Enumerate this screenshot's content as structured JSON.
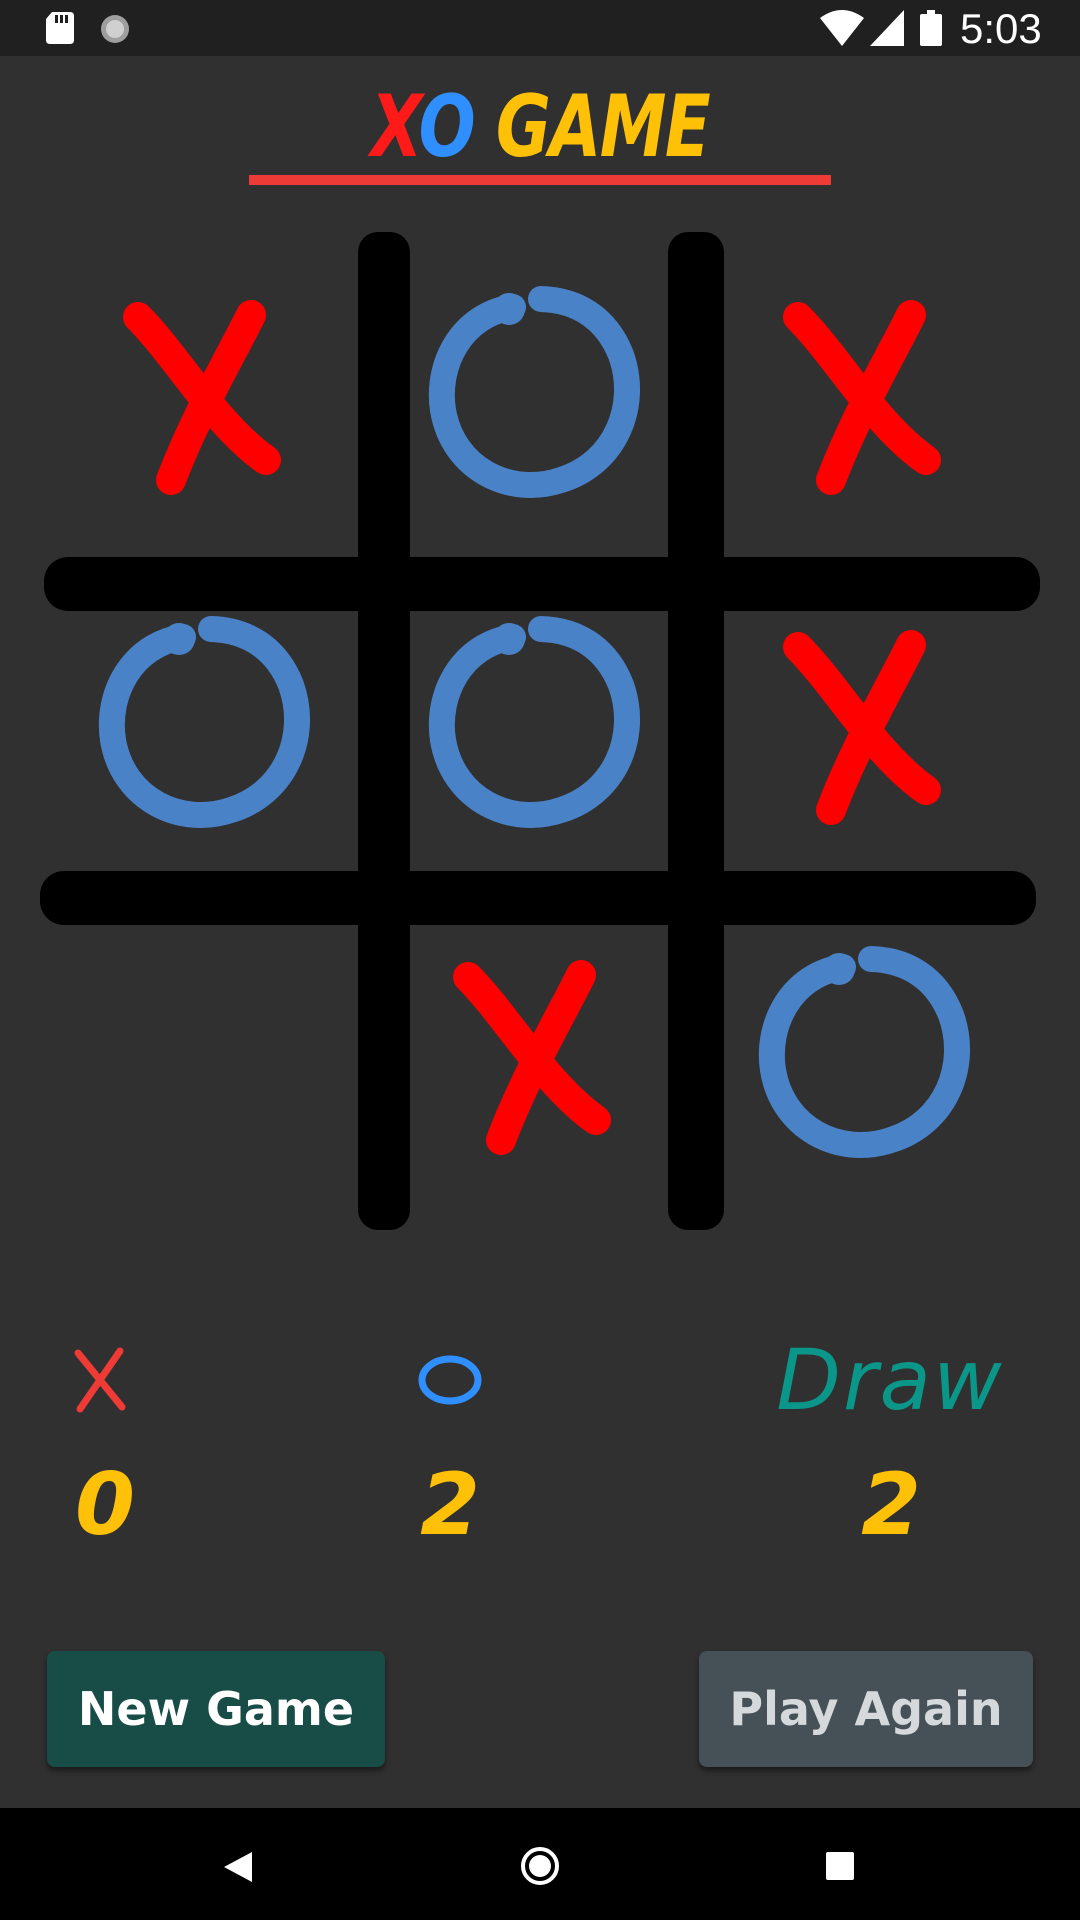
{
  "status_bar": {
    "time": "5:03",
    "icons": [
      "sd-card-icon",
      "sync-icon",
      "wifi-icon",
      "signal-icon",
      "battery-icon"
    ]
  },
  "header": {
    "title_x": "X",
    "title_o": "O",
    "title_rest": " GAME"
  },
  "board": {
    "cells": [
      "X",
      "O",
      "X",
      "O",
      "O",
      "X",
      "",
      "X",
      "O"
    ]
  },
  "scores": {
    "x_label": "X",
    "o_label": "O",
    "draw_label": "Draw",
    "x_score": "0",
    "o_score": "2",
    "draw_score": "2"
  },
  "buttons": {
    "new_game": "New Game",
    "play_again": "Play Again"
  },
  "nav": [
    "back-icon",
    "home-icon",
    "recents-icon"
  ],
  "colors": {
    "x": "#ff0000",
    "o": "#4a82c8",
    "score": "#ffc107",
    "draw": "#0a9688",
    "underline": "#ef3b36"
  }
}
